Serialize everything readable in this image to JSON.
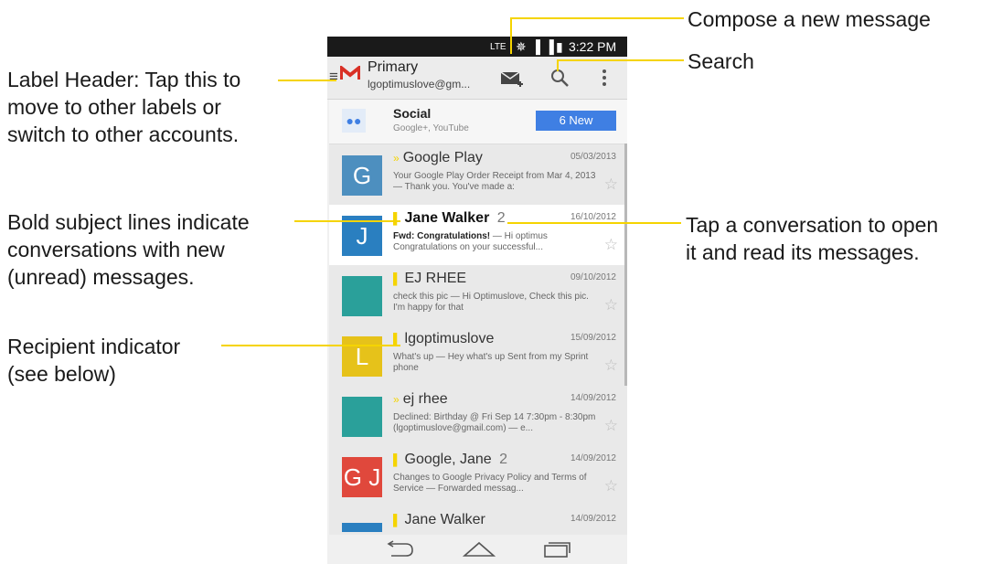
{
  "callouts": {
    "compose": "Compose a new message",
    "search": "Search",
    "label_header": [
      "Label Header: Tap this to",
      "move to other labels or",
      "switch to other accounts."
    ],
    "bold_subject": [
      "Bold subject lines indicate",
      "conversations with new",
      "(unread) messages."
    ],
    "tap_conversation": [
      "Tap a conversation to open",
      "it and read its messages."
    ],
    "recipient": [
      "Recipient indicator",
      "(see below)"
    ]
  },
  "status_bar": {
    "network": "LTE",
    "time": "3:22 PM"
  },
  "action_bar": {
    "label": "Primary",
    "account": "lgoptimuslove@gm...",
    "icons": [
      "menu-icon",
      "gmail-logo",
      "compose-icon",
      "search-icon",
      "overflow-icon"
    ]
  },
  "social": {
    "title": "Social",
    "subtitle": "Google+, YouTube",
    "badge": "6 New",
    "badge_color": "#3f7fe3"
  },
  "conversations": [
    {
      "sender": "Google Play",
      "count": "",
      "date": "05/03/2013",
      "subject": "",
      "snippet": "Your Google Play Order Receipt from Mar 4, 2013 — Thank you. You've made a:",
      "avatar_letter": "G",
      "avatar_color": "#4d8fbf",
      "unread": false,
      "marker": "»"
    },
    {
      "sender": "Jane Walker",
      "count": "2",
      "date": "16/10/2012",
      "subject": "Fwd: Congratulations!",
      "snippet": "— Hi optimus Congratulations on your successful...",
      "avatar_letter": "J",
      "avatar_color": "#2a7fc0",
      "unread": true,
      "marker": "▌"
    },
    {
      "sender": "EJ RHEE",
      "count": "",
      "date": "09/10/2012",
      "subject": "",
      "snippet": "check this pic — Hi Optimuslove, Check this pic. I'm happy for that",
      "avatar_letter": "",
      "avatar_color": "#2aa09a",
      "unread": false,
      "marker": "▌"
    },
    {
      "sender": "lgoptimuslove",
      "count": "",
      "date": "15/09/2012",
      "subject": "",
      "snippet": "What's up — Hey what's up Sent from my Sprint phone",
      "avatar_letter": "L",
      "avatar_color": "#e6c21a",
      "unread": false,
      "marker": "▌"
    },
    {
      "sender": "ej rhee",
      "count": "",
      "date": "14/09/2012",
      "subject": "",
      "snippet": "Declined: Birthday @ Fri Sep 14 7:30pm - 8:30pm (lgoptimuslove@gmail.com) — e...",
      "avatar_letter": "",
      "avatar_color": "#2aa09a",
      "unread": false,
      "marker": "»"
    },
    {
      "sender": "Google, Jane",
      "count": "2",
      "date": "14/09/2012",
      "subject": "",
      "snippet": "Changes to Google Privacy Policy and Terms of Service — Forwarded messag...",
      "avatar_letter": "G J",
      "avatar_color": "#e0483c",
      "unread": false,
      "marker": "▌"
    },
    {
      "sender": "Jane Walker",
      "count": "",
      "date": "14/09/2012",
      "subject": "",
      "snippet": "",
      "avatar_letter": "",
      "avatar_color": "#2a7fc0",
      "unread": false,
      "marker": "▌"
    }
  ],
  "nav_icons": [
    "back-icon",
    "home-icon",
    "recent-apps-icon"
  ],
  "accent_color": "#f5d400"
}
